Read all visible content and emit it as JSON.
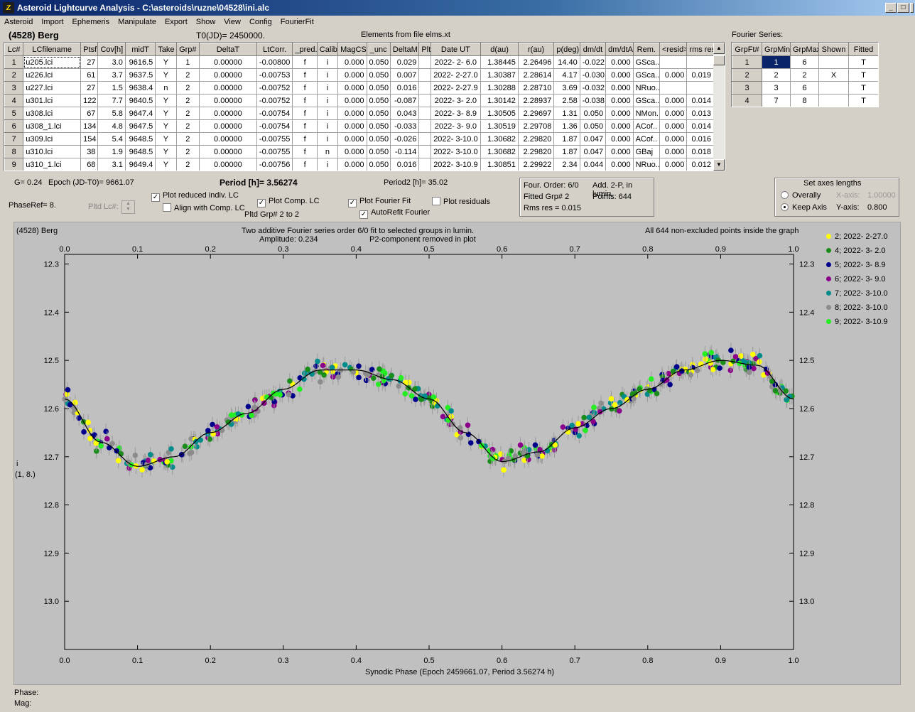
{
  "window": {
    "title": "Asteroid Lightcurve Analysis - C:\\asteroids\\ruzne\\04528\\ini.alc",
    "icon_letter": "Z"
  },
  "window_buttons": {
    "minimize": "_",
    "maximize": "□",
    "close": "X"
  },
  "menu": [
    "Asteroid",
    "Import",
    "Ephemeris",
    "Manipulate",
    "Export",
    "Show",
    "View",
    "Config",
    "FourierFit"
  ],
  "header": {
    "object": "(4528) Berg",
    "t0": "T0(JD)= 2450000.",
    "elements": "Elements from file elms.xt",
    "fourier_label": "Fourier Series:"
  },
  "lc_table": {
    "columns": [
      "Lc#",
      "LCfilename",
      "Ptsf",
      "Cov[h]",
      "midT",
      "Take",
      "Grp#",
      "DeltaT",
      "LtCorr.",
      "_pred.",
      "Calib.",
      "MagCS",
      "_unc",
      "DeltaM",
      "Plt",
      "Date UT",
      "d(au)",
      "r(au)",
      "p(deg)",
      "dm/dt",
      "dm/dtA",
      "Rem.",
      "<resid>",
      "rms res"
    ],
    "rows": [
      [
        "1",
        "u205.lci",
        "27",
        "3.0",
        "9616.5",
        "Y",
        "1",
        "0.00000",
        "-0.00800",
        "f",
        "i",
        "0.000",
        "0.050",
        "0.029",
        "",
        "2022- 2- 6.0",
        "1.38445",
        "2.26496",
        "14.40",
        "-0.022",
        "0.000",
        "GSca..",
        "",
        ""
      ],
      [
        "2",
        "u226.lci",
        "61",
        "3.7",
        "9637.5",
        "Y",
        "2",
        "0.00000",
        "-0.00753",
        "f",
        "i",
        "0.000",
        "0.050",
        "0.007",
        "",
        "2022- 2-27.0",
        "1.30387",
        "2.28614",
        "4.17",
        "-0.030",
        "0.000",
        "GSca..",
        "0.000",
        "0.019"
      ],
      [
        "3",
        "u227.lci",
        "27",
        "1.5",
        "9638.4",
        "n",
        "2",
        "0.00000",
        "-0.00752",
        "f",
        "i",
        "0.000",
        "0.050",
        "0.016",
        "",
        "2022- 2-27.9",
        "1.30288",
        "2.28710",
        "3.69",
        "-0.032",
        "0.000",
        "NRuo..",
        "",
        ""
      ],
      [
        "4",
        "u301.lci",
        "122",
        "7.7",
        "9640.5",
        "Y",
        "2",
        "0.00000",
        "-0.00752",
        "f",
        "i",
        "0.000",
        "0.050",
        "-0.087",
        "",
        "2022- 3- 2.0",
        "1.30142",
        "2.28937",
        "2.58",
        "-0.038",
        "0.000",
        "GSca..",
        "0.000",
        "0.014"
      ],
      [
        "5",
        "u308.lci",
        "67",
        "5.8",
        "9647.4",
        "Y",
        "2",
        "0.00000",
        "-0.00754",
        "f",
        "i",
        "0.000",
        "0.050",
        "0.043",
        "",
        "2022- 3- 8.9",
        "1.30505",
        "2.29697",
        "1.31",
        "0.050",
        "0.000",
        "NMon..",
        "0.000",
        "0.013"
      ],
      [
        "6",
        "u308_1.lci",
        "134",
        "4.8",
        "9647.5",
        "Y",
        "2",
        "0.00000",
        "-0.00754",
        "f",
        "i",
        "0.000",
        "0.050",
        "-0.033",
        "",
        "2022- 3- 9.0",
        "1.30519",
        "2.29708",
        "1.36",
        "0.050",
        "0.000",
        "ACof..",
        "0.000",
        "0.014"
      ],
      [
        "7",
        "u309.lci",
        "154",
        "5.4",
        "9648.5",
        "Y",
        "2",
        "0.00000",
        "-0.00755",
        "f",
        "i",
        "0.000",
        "0.050",
        "-0.026",
        "",
        "2022- 3-10.0",
        "1.30682",
        "2.29820",
        "1.87",
        "0.047",
        "0.000",
        "ACof..",
        "0.000",
        "0.016"
      ],
      [
        "8",
        "u310.lci",
        "38",
        "1.9",
        "9648.5",
        "Y",
        "2",
        "0.00000",
        "-0.00755",
        "f",
        "n",
        "0.000",
        "0.050",
        "-0.114",
        "",
        "2022- 3-10.0",
        "1.30682",
        "2.29820",
        "1.87",
        "0.047",
        "0.000",
        "GBaj",
        "0.000",
        "0.018"
      ],
      [
        "9",
        "u310_1.lci",
        "68",
        "3.1",
        "9649.4",
        "Y",
        "2",
        "0.00000",
        "-0.00756",
        "f",
        "i",
        "0.000",
        "0.050",
        "0.016",
        "",
        "2022- 3-10.9",
        "1.30851",
        "2.29922",
        "2.34",
        "0.044",
        "0.000",
        "NRuo..",
        "0.000",
        "0.012"
      ]
    ]
  },
  "fourier_table": {
    "columns": [
      "GrpFt#",
      "GrpMin",
      "GrpMax",
      "Shown",
      "Fitted"
    ],
    "rows": [
      [
        "1",
        "1",
        "6",
        "",
        "T"
      ],
      [
        "2",
        "2",
        "2",
        "X",
        "T"
      ],
      [
        "3",
        "3",
        "6",
        "",
        "T"
      ],
      [
        "4",
        "7",
        "8",
        "",
        "T"
      ]
    ]
  },
  "info": {
    "g": "G= 0.24",
    "epoch": "Epoch (JD-T0)= 9661.07",
    "period": "Period [h]= 3.56274",
    "period2": "Period2 [h]= 35.02",
    "phaseref": "PhaseRef= 8.",
    "pltd_lc": "Pltd Lc#:",
    "pltd_grp": "Pltd Grp#  2  to  2"
  },
  "checks": {
    "plot_reduced": {
      "label": "Plot reduced indiv. LC",
      "checked": true
    },
    "align": {
      "label": "Align with Comp. LC",
      "checked": false
    },
    "plot_comp": {
      "label": "Plot Comp. LC",
      "checked": true
    },
    "plot_fourier": {
      "label": "Plot Fourier Fit",
      "checked": true
    },
    "autorefit": {
      "label": "AutoRefit Fourier",
      "checked": true
    },
    "plot_resid": {
      "label": "Plot residuals",
      "checked": false
    }
  },
  "fourier_info": {
    "order": "Four. Order:  6/0",
    "fitted": "Fitted Grp# 2",
    "rms": "Rms res     = 0.015",
    "add": "Add. 2-P, in lumin.",
    "points": "Points: 644"
  },
  "axes_box": {
    "title": "Set axes lengths",
    "overall": "Overally",
    "keep": "Keep Axis",
    "xaxis_label": "X-axis:",
    "xaxis_value": "1.00000",
    "yaxis_label": "Y-axis:",
    "yaxis_value": "0.800"
  },
  "chart_data": {
    "type": "scatter",
    "object_label": "(4528) Berg",
    "title": "Two additive Fourier series order 6/0 fit to selected groups in lumin.",
    "subtitle1": "Amplitude: 0.234",
    "subtitle2": "P2-component removed in plot",
    "note": "All 644 non-excluded points inside the graph",
    "xlabel": "Synodic Phase (Epoch 2459661.07, Period 3.56274 h)",
    "ylabel": "i",
    "ylabel2": "(1, 8.)",
    "xlim": [
      0,
      1
    ],
    "ylim": [
      13.1,
      12.28
    ],
    "y_inverted": true,
    "x_ticks": [
      "0.0",
      "0.1",
      "0.2",
      "0.3",
      "0.4",
      "0.5",
      "0.6",
      "0.7",
      "0.8",
      "0.9",
      "1.0"
    ],
    "y_ticks": [
      "12.3",
      "12.4",
      "12.5",
      "12.6",
      "12.7",
      "12.8",
      "12.9",
      "13.0"
    ],
    "fit_curve": {
      "x": [
        0.0,
        0.05,
        0.1,
        0.15,
        0.2,
        0.25,
        0.3,
        0.35,
        0.4,
        0.45,
        0.5,
        0.55,
        0.6,
        0.65,
        0.7,
        0.75,
        0.8,
        0.85,
        0.9,
        0.95,
        1.0
      ],
      "y": [
        12.58,
        12.67,
        12.72,
        12.7,
        12.65,
        12.61,
        12.56,
        12.52,
        12.52,
        12.54,
        12.58,
        12.65,
        12.71,
        12.69,
        12.64,
        12.6,
        12.56,
        12.52,
        12.5,
        12.51,
        12.58
      ]
    },
    "legend_position": "right",
    "series": [
      {
        "name": "2; 2022- 2-27.0",
        "color": "#ffff00"
      },
      {
        "name": "4; 2022- 3- 2.0",
        "color": "#1a8c1a"
      },
      {
        "name": "5; 2022- 3- 8.9",
        "color": "#00008b"
      },
      {
        "name": "6; 2022- 3- 9.0",
        "color": "#8b008b"
      },
      {
        "name": "7; 2022- 3-10.0",
        "color": "#008b8b"
      },
      {
        "name": "8; 2022- 3-10.0",
        "color": "#8c8c8c"
      },
      {
        "name": "9; 2022- 3-10.9",
        "color": "#22ee22"
      }
    ]
  },
  "status": {
    "phase": "Phase:",
    "mag": "Mag:"
  }
}
